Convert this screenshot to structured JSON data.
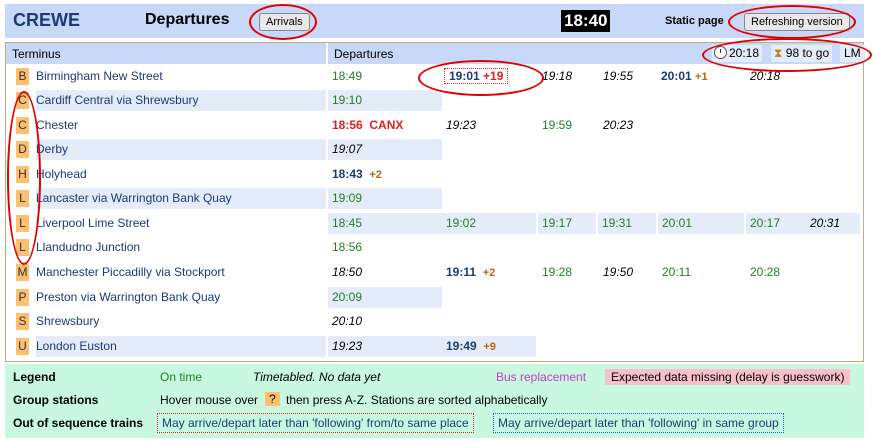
{
  "header": {
    "station": "CREWE",
    "title": "Departures",
    "arrivals_button": "Arrivals",
    "clock": "18:40",
    "static_label": "Static page",
    "refresh_button": "Refreshing version"
  },
  "board": {
    "col_terminus": "Terminus",
    "col_departures": "Departures",
    "status_time": "20:18",
    "status_togo": "98 to go",
    "status_lm": "LM",
    "rows": [
      {
        "letter": "B",
        "name": "Birmingham New Street"
      },
      {
        "letter": "C",
        "name": "Cardiff Central via Shrewsbury"
      },
      {
        "letter": "C",
        "name": "Chester"
      },
      {
        "letter": "D",
        "name": "Derby"
      },
      {
        "letter": "H",
        "name": "Holyhead"
      },
      {
        "letter": "L",
        "name": "Lancaster via Warrington Bank Quay"
      },
      {
        "letter": "L",
        "name": "Liverpool Lime Street"
      },
      {
        "letter": "L",
        "name": "Llandudno Junction"
      },
      {
        "letter": "M",
        "name": "Manchester Piccadilly via Stockport"
      },
      {
        "letter": "P",
        "name": "Preston via Warrington Bank Quay"
      },
      {
        "letter": "S",
        "name": "Shrewsbury"
      },
      {
        "letter": "U",
        "name": "London Euston"
      }
    ],
    "times": {
      "r0": {
        "a": "18:49",
        "b": "19:01",
        "b_delay": "+19",
        "c": "19:18",
        "d": "19:55",
        "e": "20:01",
        "e_delay": "+1",
        "f": "20:18"
      },
      "r1": {
        "a": "19:10"
      },
      "r2": {
        "a": "18:56",
        "a_status": "CANX",
        "b": "19:23",
        "c": "19:59",
        "d": "20:23"
      },
      "r3": {
        "a": "19:07"
      },
      "r4": {
        "a": "18:43",
        "a_delay": "+2"
      },
      "r5": {
        "a": "19:09"
      },
      "r6": {
        "a": "18:45",
        "b": "19:02",
        "c": "19:17",
        "d": "19:31",
        "e": "20:01",
        "f": "20:17",
        "g": "20:31"
      },
      "r7": {
        "a": "18:56"
      },
      "r8": {
        "a": "18:50",
        "b": "19:11",
        "b_delay": "+2",
        "c": "19:28",
        "d": "19:50",
        "e": "20:11",
        "f": "20:28"
      },
      "r9": {
        "a": "20:09"
      },
      "r10": {
        "a": "20:10"
      },
      "r11": {
        "a": "19:23",
        "b": "19:49",
        "b_delay": "+9"
      }
    }
  },
  "legend": {
    "legend_label": "Legend",
    "on_time": "On time",
    "timetabled": "Timetabled. No data yet",
    "bus": "Bus replacement",
    "missing": "Expected data missing (delay is guesswork)",
    "group_label": "Group stations",
    "hover": "Hover mouse over",
    "q": "?",
    "then_press": "then press A-Z. Stations are sorted alphabetically",
    "oos_label": "Out of sequence trains",
    "oos_red": "May arrive/depart later than 'following' from/to same place",
    "oos_blue": "May arrive/depart later than 'following' in same group"
  },
  "colors": {
    "header_bg": "#c8d8f8",
    "legend_bg": "#c8f8e0",
    "letter_bg": "#fcc070",
    "on_time": "#208020",
    "cancel": "#e02020"
  }
}
